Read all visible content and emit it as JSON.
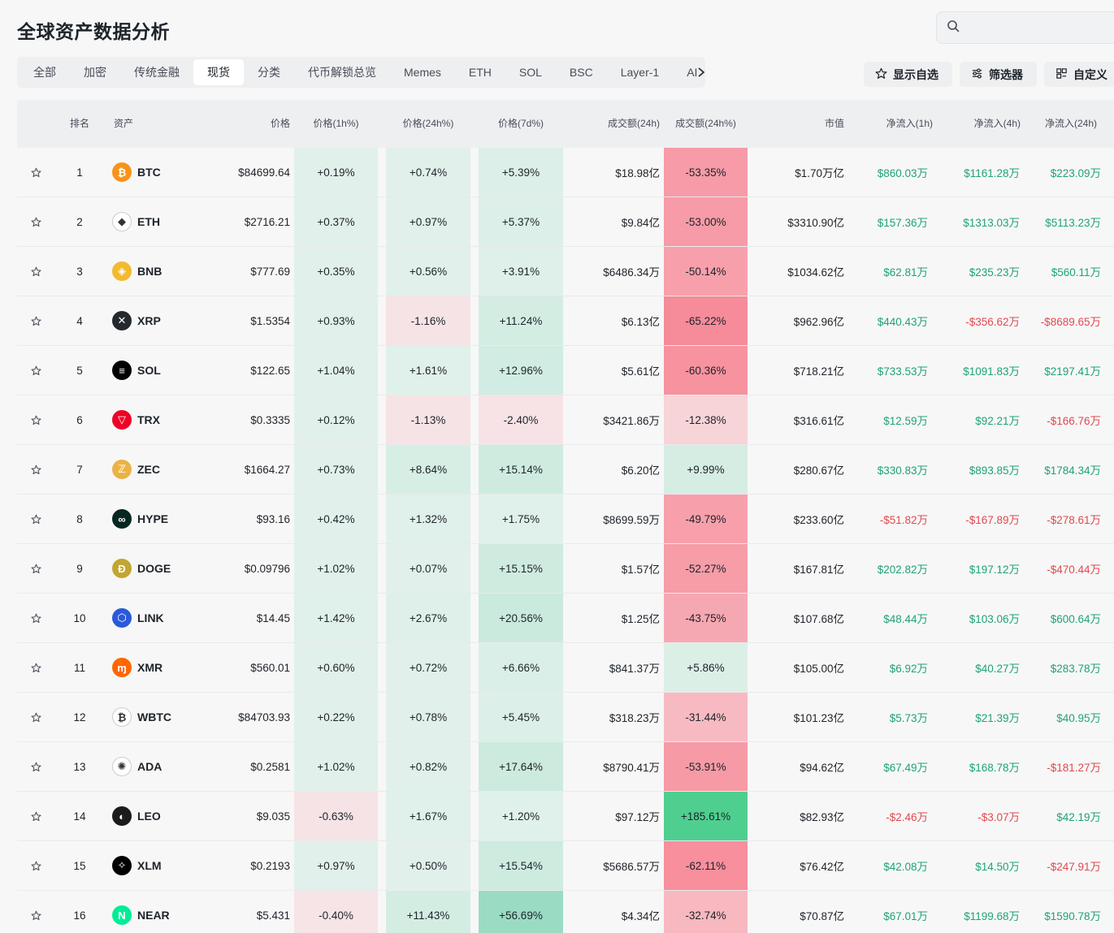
{
  "page": {
    "title": "全球资产数据分析"
  },
  "search": {
    "placeholder": ""
  },
  "tabs": [
    "全部",
    "加密",
    "传统金融",
    "现货",
    "分类",
    "代币解锁总览",
    "Memes",
    "ETH",
    "SOL",
    "BSC",
    "Layer-1",
    "AI"
  ],
  "active_tab": "现货",
  "actions": {
    "watchlist": "显示自选",
    "filter": "筛选器",
    "customize": "自定义"
  },
  "columns": [
    "排名",
    "资产",
    "价格",
    "价格(1h%)",
    "价格(24h%)",
    "价格(7d%)",
    "成交额(24h)",
    "成交额(24h%)",
    "市值",
    "净流入(1h)",
    "净流入(4h)",
    "净流入(24h)"
  ],
  "colors": {
    "positive": "#1fa374",
    "negative": "#e1494f"
  },
  "rows": [
    {
      "rank": "1",
      "symbol": "BTC",
      "icon": "bitcoin-icon",
      "icon_color": "#f7931a",
      "glyph": "₿",
      "price": "$84699.64",
      "h1": "+0.19%",
      "h24": "+0.74%",
      "d7": "+5.39%",
      "vol": "$18.98亿",
      "vol_pct": "-53.35%",
      "mcap": "$1.70万亿",
      "in1h": "$860.03万",
      "in4h": "$1161.28万",
      "in24h": "$223.09万"
    },
    {
      "rank": "2",
      "symbol": "ETH",
      "icon": "ethereum-icon",
      "icon_color": "#ffffff",
      "glyph": "◆",
      "price": "$2716.21",
      "h1": "+0.37%",
      "h24": "+0.97%",
      "d7": "+5.37%",
      "vol": "$9.84亿",
      "vol_pct": "-53.00%",
      "mcap": "$3310.90亿",
      "in1h": "$157.36万",
      "in4h": "$1313.03万",
      "in24h": "$5113.23万"
    },
    {
      "rank": "3",
      "symbol": "BNB",
      "icon": "bnb-icon",
      "icon_color": "#f3ba2f",
      "glyph": "◈",
      "price": "$777.69",
      "h1": "+0.35%",
      "h24": "+0.56%",
      "d7": "+3.91%",
      "vol": "$6486.34万",
      "vol_pct": "-50.14%",
      "mcap": "$1034.62亿",
      "in1h": "$62.81万",
      "in4h": "$235.23万",
      "in24h": "$560.11万"
    },
    {
      "rank": "4",
      "symbol": "XRP",
      "icon": "xrp-icon",
      "icon_color": "#23292f",
      "glyph": "✕",
      "price": "$1.5354",
      "h1": "+0.93%",
      "h24": "-1.16%",
      "d7": "+11.24%",
      "vol": "$6.13亿",
      "vol_pct": "-65.22%",
      "mcap": "$962.96亿",
      "in1h": "$440.43万",
      "in4h": "-$356.62万",
      "in24h": "-$8689.65万"
    },
    {
      "rank": "5",
      "symbol": "SOL",
      "icon": "solana-icon",
      "icon_color": "#000000",
      "glyph": "≡",
      "price": "$122.65",
      "h1": "+1.04%",
      "h24": "+1.61%",
      "d7": "+12.96%",
      "vol": "$5.61亿",
      "vol_pct": "-60.36%",
      "mcap": "$718.21亿",
      "in1h": "$733.53万",
      "in4h": "$1091.83万",
      "in24h": "$2197.41万"
    },
    {
      "rank": "6",
      "symbol": "TRX",
      "icon": "tron-icon",
      "icon_color": "#ef0027",
      "glyph": "▽",
      "price": "$0.3335",
      "h1": "+0.12%",
      "h24": "-1.13%",
      "d7": "-2.40%",
      "vol": "$3421.86万",
      "vol_pct": "-12.38%",
      "mcap": "$316.61亿",
      "in1h": "$12.59万",
      "in4h": "$92.21万",
      "in24h": "-$166.76万"
    },
    {
      "rank": "7",
      "symbol": "ZEC",
      "icon": "zcash-icon",
      "icon_color": "#ecb244",
      "glyph": "ℤ",
      "price": "$1664.27",
      "h1": "+0.73%",
      "h24": "+8.64%",
      "d7": "+15.14%",
      "vol": "$6.20亿",
      "vol_pct": "+9.99%",
      "mcap": "$280.67亿",
      "in1h": "$330.83万",
      "in4h": "$893.85万",
      "in24h": "$1784.34万"
    },
    {
      "rank": "8",
      "symbol": "HYPE",
      "icon": "hyperliquid-icon",
      "icon_color": "#072723",
      "glyph": "∞",
      "price": "$93.16",
      "h1": "+0.42%",
      "h24": "+1.32%",
      "d7": "+1.75%",
      "vol": "$8699.59万",
      "vol_pct": "-49.79%",
      "mcap": "$233.60亿",
      "in1h": "-$51.82万",
      "in4h": "-$167.89万",
      "in24h": "-$278.61万"
    },
    {
      "rank": "9",
      "symbol": "DOGE",
      "icon": "dogecoin-icon",
      "icon_color": "#c2a633",
      "glyph": "Ð",
      "price": "$0.09796",
      "h1": "+1.02%",
      "h24": "+0.07%",
      "d7": "+15.15%",
      "vol": "$1.57亿",
      "vol_pct": "-52.27%",
      "mcap": "$167.81亿",
      "in1h": "$202.82万",
      "in4h": "$197.12万",
      "in24h": "-$470.44万"
    },
    {
      "rank": "10",
      "symbol": "LINK",
      "icon": "chainlink-icon",
      "icon_color": "#2a5ada",
      "glyph": "⬡",
      "price": "$14.45",
      "h1": "+1.42%",
      "h24": "+2.67%",
      "d7": "+20.56%",
      "vol": "$1.25亿",
      "vol_pct": "-43.75%",
      "mcap": "$107.68亿",
      "in1h": "$48.44万",
      "in4h": "$103.06万",
      "in24h": "$600.64万"
    },
    {
      "rank": "11",
      "symbol": "XMR",
      "icon": "monero-icon",
      "icon_color": "#ff6600",
      "glyph": "ɱ",
      "price": "$560.01",
      "h1": "+0.60%",
      "h24": "+0.72%",
      "d7": "+6.66%",
      "vol": "$841.37万",
      "vol_pct": "+5.86%",
      "mcap": "$105.00亿",
      "in1h": "$6.92万",
      "in4h": "$40.27万",
      "in24h": "$283.78万"
    },
    {
      "rank": "12",
      "symbol": "WBTC",
      "icon": "wrapped-bitcoin-icon",
      "icon_color": "#ffffff",
      "glyph": "₿",
      "price": "$84703.93",
      "h1": "+0.22%",
      "h24": "+0.78%",
      "d7": "+5.45%",
      "vol": "$318.23万",
      "vol_pct": "-31.44%",
      "mcap": "$101.23亿",
      "in1h": "$5.73万",
      "in4h": "$21.39万",
      "in24h": "$40.95万"
    },
    {
      "rank": "13",
      "symbol": "ADA",
      "icon": "cardano-icon",
      "icon_color": "#ffffff",
      "glyph": "✺",
      "price": "$0.2581",
      "h1": "+1.02%",
      "h24": "+0.82%",
      "d7": "+17.64%",
      "vol": "$8790.41万",
      "vol_pct": "-53.91%",
      "mcap": "$94.62亿",
      "in1h": "$67.49万",
      "in4h": "$168.78万",
      "in24h": "-$181.27万"
    },
    {
      "rank": "14",
      "symbol": "LEO",
      "icon": "leo-icon",
      "icon_color": "#1b1b1b",
      "glyph": "◐",
      "price": "$9.035",
      "h1": "-0.63%",
      "h24": "+1.67%",
      "d7": "+1.20%",
      "vol": "$97.12万",
      "vol_pct": "+185.61%",
      "mcap": "$82.93亿",
      "in1h": "-$2.46万",
      "in4h": "-$3.07万",
      "in24h": "$42.19万"
    },
    {
      "rank": "15",
      "symbol": "XLM",
      "icon": "stellar-icon",
      "icon_color": "#000000",
      "glyph": "✧",
      "price": "$0.2193",
      "h1": "+0.97%",
      "h24": "+0.50%",
      "d7": "+15.54%",
      "vol": "$5686.57万",
      "vol_pct": "-62.11%",
      "mcap": "$76.42亿",
      "in1h": "$42.08万",
      "in4h": "$14.50万",
      "in24h": "-$247.91万"
    },
    {
      "rank": "16",
      "symbol": "NEAR",
      "icon": "near-icon",
      "icon_color": "#00ec97",
      "glyph": "N",
      "price": "$5.431",
      "h1": "-0.40%",
      "h24": "+11.43%",
      "d7": "+56.69%",
      "vol": "$4.34亿",
      "vol_pct": "-32.74%",
      "mcap": "$70.87亿",
      "in1h": "$67.01万",
      "in4h": "$1199.68万",
      "in24h": "$1590.78万"
    }
  ]
}
